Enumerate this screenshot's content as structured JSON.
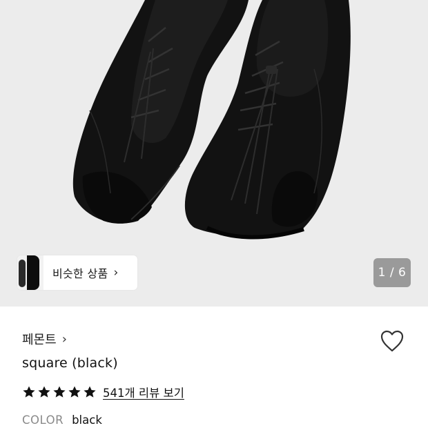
{
  "gallery": {
    "similar_products_label": "비슷한 상품",
    "similar_products_chevron": "›",
    "counter": "1 / 6"
  },
  "product": {
    "brand": "페몬트",
    "brand_chevron": "›",
    "title": "square (black)",
    "rating_stars": 5,
    "review_link": "541개 리뷰 보기",
    "color_label": "COLOR",
    "color_value": "black"
  },
  "icons": {
    "heart": "heart-outline-icon",
    "star": "star-filled-icon"
  },
  "colors": {
    "gallery_bg": "#ececec",
    "counter_bg": "#9a9a9a",
    "accent_text": "#111111",
    "muted_text": "#8a8a8a"
  }
}
